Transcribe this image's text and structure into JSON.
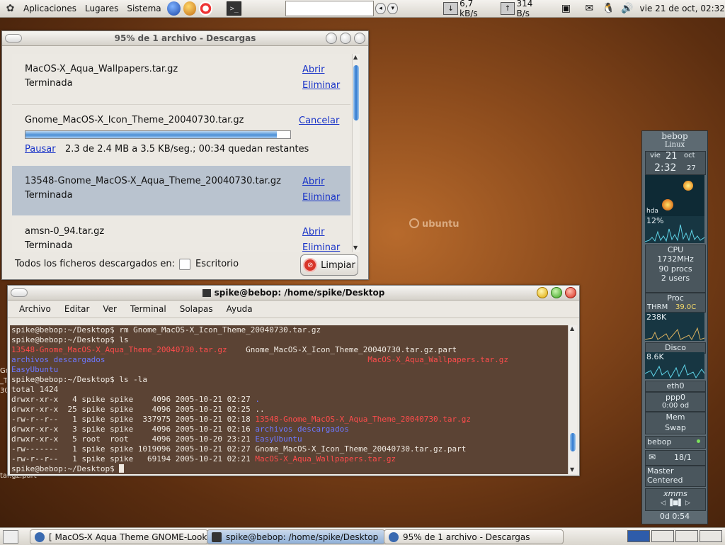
{
  "top_panel": {
    "menus": [
      "Aplicaciones",
      "Lugares",
      "Sistema"
    ],
    "net_down": "6,7 kB/s",
    "net_up": "314 B/s",
    "clock": "vie 21 de oct, 02:32"
  },
  "downloads_window": {
    "title": "95% de 1 archivo - Descargas",
    "items": [
      {
        "filename": "MacOS-X_Aqua_Wallpapers.tar.gz",
        "status": "Terminada",
        "open": "Abrir",
        "remove": "Eliminar"
      },
      {
        "filename": "Gnome_MacOS-X_Icon_Theme_20040730.tar.gz",
        "cancel": "Cancelar",
        "pause": "Pausar",
        "progress_text": "2.3 de 2.4 MB a 3.5 KB/seg.; 00:34 quedan restantes",
        "progress_fraction": 0.95
      },
      {
        "filename": "13548-Gnome_MacOS-X_Aqua_Theme_20040730.tar.gz",
        "status": "Terminada",
        "open": "Abrir",
        "remove": "Eliminar"
      },
      {
        "filename": "amsn-0_94.tar.gz",
        "status": "Terminada",
        "open": "Abrir",
        "remove": "Eliminar"
      }
    ],
    "footer_label": "Todos los ficheros descargados en:",
    "folder": "Escritorio",
    "clean_button": "Limpiar"
  },
  "terminal_window": {
    "title": "spike@bebop: /home/spike/Desktop",
    "menu": [
      "Archivo",
      "Editar",
      "Ver",
      "Terminal",
      "Solapas",
      "Ayuda"
    ],
    "lines": [
      {
        "t": "spike@bebop:~/Desktop$ rm Gnome_MacOS-X_Icon_Theme_20040730.tar.gz"
      },
      {
        "t": "spike@bebop:~/Desktop$ ls"
      },
      {
        "t": "13548-Gnome_MacOS-X_Aqua_Theme_20040730.tar.gz",
        "c": "red",
        "t2": "Gnome_MacOS-X_Icon_Theme_20040730.tar.gz.part"
      },
      {
        "t": "archivos descargados",
        "c": "blue",
        "t2": "MacOS-X_Aqua_Wallpapers.tar.gz",
        "c2": "red"
      },
      {
        "t": "EasyUbuntu",
        "c": "blue"
      },
      {
        "t": "spike@bebop:~/Desktop$ ls -la"
      },
      {
        "t": "total 1424"
      },
      {
        "t": "drwxr-xr-x   4 spike spike    4096 2005-10-21 02:27",
        "t2": ".",
        "c2": "blue"
      },
      {
        "t": "drwxr-xr-x  25 spike spike    4096 2005-10-21 02:25",
        "t2": ".."
      },
      {
        "t": "-rw-r--r--   1 spike spike  337975 2005-10-21 02:18",
        "t2": "13548-Gnome_MacOS-X_Aqua_Theme_20040730.tar.gz",
        "c2": "red"
      },
      {
        "t": "drwxr-xr-x   3 spike spike    4096 2005-10-21 02:16",
        "t2": "archivos descargados",
        "c2": "blue"
      },
      {
        "t": "drwxr-xr-x   5 root  root     4096 2005-10-20 23:21",
        "t2": "EasyUbuntu",
        "c2": "blue"
      },
      {
        "t": "-rw-------   1 spike spike 1019096 2005-10-21 02:27",
        "t2": "Gnome_MacOS-X_Icon_Theme_20040730.tar.gz.part"
      },
      {
        "t": "-rw-r--r--   1 spike spike   69194 2005-10-21 02:21",
        "t2": "MacOS-X_Aqua_Wallpapers.tar.gz",
        "c2": "red"
      },
      {
        "t": "spike@bebop:~/Desktop$ ",
        "cursor": true
      }
    ]
  },
  "desktop": {
    "logo_text": "ubuntu",
    "fragment_1": "Gn",
    "fragment_2": "_T",
    "fragment_3": "30",
    "fragment_4": "tar.gz.part"
  },
  "gkrellm": {
    "host": "bebop",
    "os": "Linux",
    "day": "vie",
    "date": "21",
    "month": "oct",
    "time": "2:32",
    "seconds": "27",
    "hda_label": "hda",
    "hda_pct": "12%",
    "cpu_label": "CPU",
    "cpu_freq": "1732MHz",
    "procs": "90 procs",
    "users": "2 users",
    "proc_label": "Proc",
    "thrm_label": "THRM",
    "thrm_value": "39.0C",
    "proc_mem": "238K",
    "disk_label": "Disco",
    "disk_value": "8.6K",
    "eth_label": "eth0",
    "ppp_label": "ppp0",
    "ppp_time": "0:00 od",
    "mem_label": "Mem",
    "swap_label": "Swap",
    "host2": "bebop",
    "mail_count": "18/1",
    "mixer_1": "Master",
    "mixer_2": "Centered",
    "xmms_label": "xmms",
    "uptime": "0d  0:54"
  },
  "taskbar": {
    "tasks": [
      {
        "label": "[ MacOS-X Aqua Theme GNOME-Look...",
        "icon": "firefox-icon"
      },
      {
        "label": "spike@bebop: /home/spike/Desktop",
        "icon": "terminal-icon"
      },
      {
        "label": "95% de 1 archivo - Descargas",
        "icon": "firefox-icon"
      }
    ]
  }
}
